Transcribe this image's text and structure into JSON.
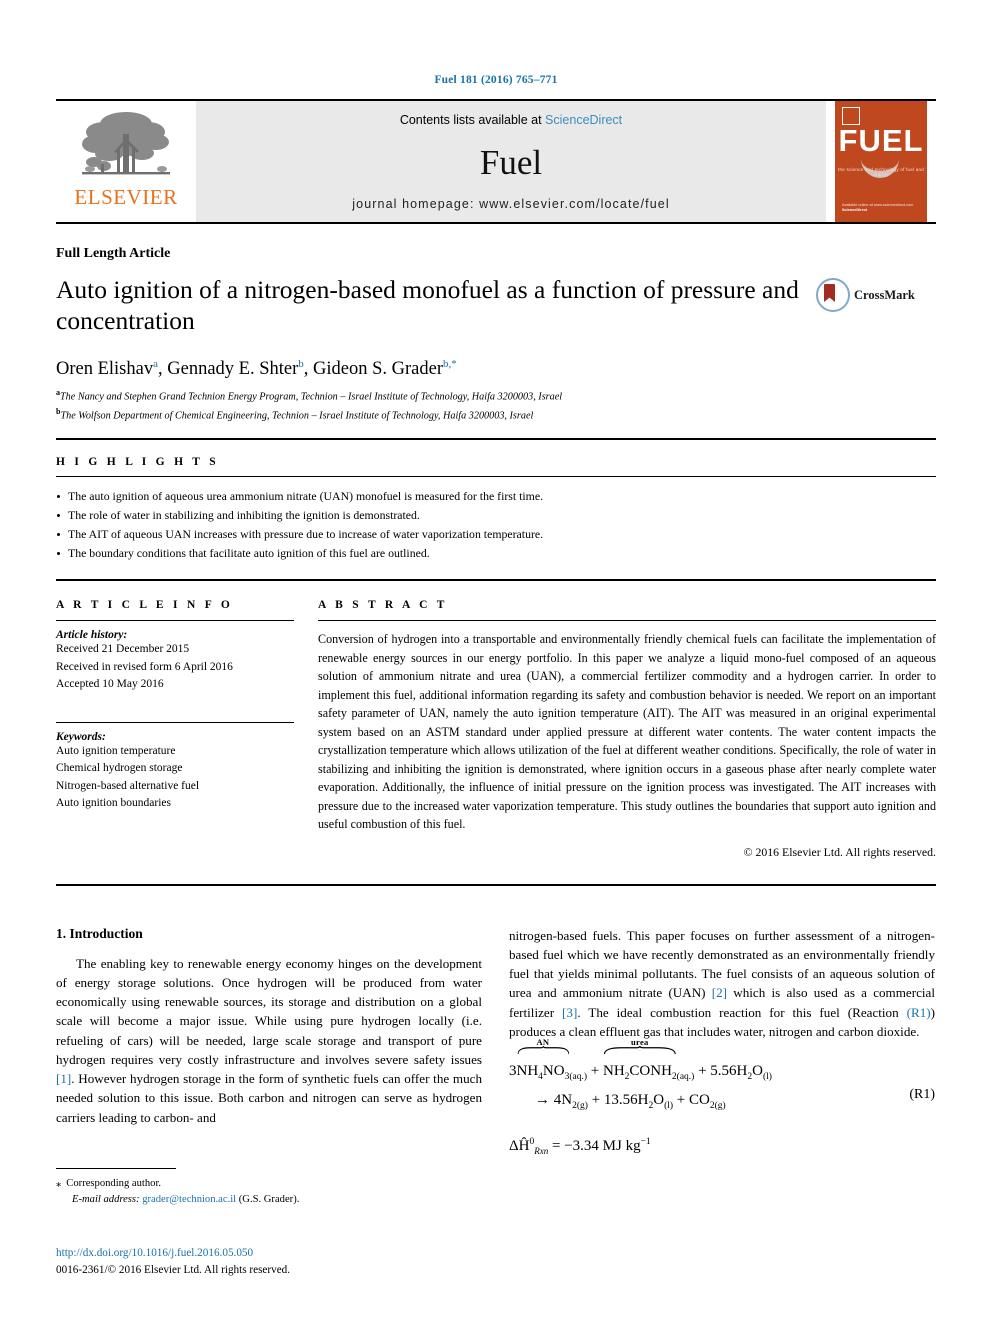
{
  "running_head": "Fuel 181 (2016) 765–771",
  "masthead": {
    "publisher_name": "ELSEVIER",
    "contents_prefix": "Contents lists available at",
    "sciencedirect": "ScienceDirect",
    "journal_name": "Fuel",
    "homepage": "journal homepage: www.elsevier.com/locate/fuel",
    "cover": {
      "title": "FUEL",
      "subtitle": "the science and technology of fuel and energy",
      "footer_line1": "Available online at www.sciencedirect.com",
      "footer_line2": "ScienceDirect"
    }
  },
  "article": {
    "kicker": "Full Length Article",
    "title": "Auto ignition of a nitrogen-based monofuel as a function of pressure and concentration",
    "crossmark_label": "CrossMark",
    "authors_html": "Oren Elishav<sup>a</sup>, Gennady E. Shter<sup>b</sup>, Gideon S. Grader<sup>b,*</sup>",
    "affiliations": [
      {
        "marker": "a",
        "text": "The Nancy and Stephen Grand Technion Energy Program, Technion – Israel Institute of Technology, Haifa 3200003, Israel"
      },
      {
        "marker": "b",
        "text": "The Wolfson Department of Chemical Engineering, Technion – Israel Institute of Technology, Haifa 3200003, Israel"
      }
    ]
  },
  "highlights": {
    "label": "H I G H L I G H T S",
    "items": [
      "The auto ignition of aqueous urea ammonium nitrate (UAN) monofuel is measured for the first time.",
      "The role of water in stabilizing and inhibiting the ignition is demonstrated.",
      "The AIT of aqueous UAN increases with pressure due to increase of water vaporization temperature.",
      "The boundary conditions that facilitate auto ignition of this fuel are outlined."
    ]
  },
  "article_info": {
    "label": "A R T I C L E   I N F O",
    "history_label": "Article history:",
    "history": [
      "Received 21 December 2015",
      "Received in revised form 6 April 2016",
      "Accepted 10 May 2016"
    ],
    "keywords_label": "Keywords:",
    "keywords": [
      "Auto ignition temperature",
      "Chemical hydrogen storage",
      "Nitrogen-based alternative fuel",
      "Auto ignition boundaries"
    ]
  },
  "abstract": {
    "label": "A B S T R A C T",
    "text": "Conversion of hydrogen into a transportable and environmentally friendly chemical fuels can facilitate the implementation of renewable energy sources in our energy portfolio. In this paper we analyze a liquid mono-fuel composed of an aqueous solution of ammonium nitrate and urea (UAN), a commercial fertilizer commodity and a hydrogen carrier. In order to implement this fuel, additional information regarding its safety and combustion behavior is needed. We report on an important safety parameter of UAN, namely the auto ignition temperature (AIT). The AIT was measured in an original experimental system based on an ASTM standard under applied pressure at different water contents. The water content impacts the crystallization temperature which allows utilization of the fuel at different weather conditions. Specifically, the role of water in stabilizing and inhibiting the ignition is demonstrated, where ignition occurs in a gaseous phase after nearly complete water evaporation. Additionally, the influence of initial pressure on the ignition process was investigated. The AIT increases with pressure due to the increased water vaporization temperature. This study outlines the boundaries that support auto ignition and useful combustion of this fuel.",
    "copyright": "© 2016 Elsevier Ltd. All rights reserved."
  },
  "introduction": {
    "heading": "1. Introduction",
    "left_para_part1": "The enabling key to renewable energy economy hinges on the development of energy storage solutions. Once hydrogen will be produced from water economically using renewable sources, its storage and distribution on a global scale will become a major issue. While using pure hydrogen locally (i.e. refueling of cars) will be needed, large scale storage and transport of pure hydrogen requires very costly infrastructure and involves severe safety issues ",
    "ref1": "[1]",
    "left_para_part2": ". However hydrogen storage in the form of synthetic fuels can offer the much needed solution to this issue. Both carbon and nitrogen can serve as hydrogen carriers leading to carbon- and",
    "right_para_part1": "nitrogen-based fuels. This paper focuses on further assessment of a nitrogen-based fuel which we have recently demonstrated as an environmentally friendly fuel that yields minimal pollutants. The fuel consists of an aqueous solution of urea and ammonium nitrate (UAN) ",
    "ref2": "[2]",
    "right_para_part2": " which is also used as a commercial fertilizer ",
    "ref3": "[3]",
    "right_para_part3": ". The ideal combustion reaction for this fuel (Reaction ",
    "refR1": "(R1)",
    "right_para_part4": ") produces a clean effluent gas that includes water, nitrogen and carbon dioxide."
  },
  "equation": {
    "brace_label_an": "AN",
    "brace_label_urea": "urea",
    "tag": "(R1)",
    "enthalpy_delta": "ΔĤ",
    "enthalpy_sup": "0",
    "enthalpy_sub": "Rxn",
    "enthalpy_value": "= −3.34 MJ kg",
    "enthalpy_value_sup": "−1"
  },
  "footnote": {
    "star": "⁎",
    "corresponding": "Corresponding author.",
    "email_label": "E-mail address:",
    "email": "grader@technion.ac.il",
    "email_owner": "(G.S. Grader)."
  },
  "footer": {
    "doi": "http://dx.doi.org/10.1016/j.fuel.2016.05.050",
    "issn": "0016-2361/© 2016 Elsevier Ltd. All rights reserved."
  },
  "colors": {
    "link": "#1a72a8",
    "elsevier_orange": "#E9711C",
    "cover_orange": "#C0481F"
  }
}
